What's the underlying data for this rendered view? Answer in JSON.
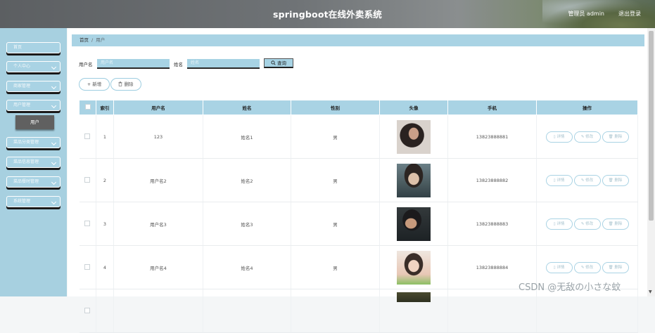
{
  "header": {
    "title": "springboot在线外卖系统",
    "user_text": "管理员 admin",
    "logout_label": "退出登录"
  },
  "sidebar": {
    "items": [
      {
        "label": "首页",
        "has_chevron": false
      },
      {
        "label": "个人中心",
        "has_chevron": true
      },
      {
        "label": "商家管理",
        "has_chevron": true
      },
      {
        "label": "用户管理",
        "has_chevron": true
      },
      {
        "label": "菜品分类管理",
        "has_chevron": true
      },
      {
        "label": "菜品信息管理",
        "has_chevron": true
      },
      {
        "label": "菜品餐时管理",
        "has_chevron": true
      },
      {
        "label": "系统管理",
        "has_chevron": true
      }
    ],
    "active_submenu": "用户"
  },
  "breadcrumb": {
    "home": "首页",
    "separator": "/",
    "current": "用户"
  },
  "search": {
    "username_label": "用户名",
    "username_placeholder": "用户名",
    "name_label": "姓名",
    "name_placeholder": "姓名",
    "search_button": "查询",
    "search_icon": "search-icon"
  },
  "actions": {
    "add_label": "新增",
    "delete_label": "删除"
  },
  "table": {
    "columns": [
      "索引",
      "用户名",
      "姓名",
      "性别",
      "头像",
      "手机",
      "操作"
    ],
    "rows": [
      {
        "index": "1",
        "username": "123",
        "name": "姓名1",
        "gender": "男",
        "phone": "13823888881"
      },
      {
        "index": "2",
        "username": "用户名2",
        "name": "姓名2",
        "gender": "男",
        "phone": "13823888882"
      },
      {
        "index": "3",
        "username": "用户名3",
        "name": "姓名3",
        "gender": "男",
        "phone": "13823888883"
      },
      {
        "index": "4",
        "username": "用户名4",
        "name": "姓名4",
        "gender": "男",
        "phone": "13823888884"
      }
    ],
    "row_actions": {
      "detail": "详情",
      "edit": "修改",
      "delete": "删除"
    }
  },
  "watermark": "CSDN @无敌の小さな蚊",
  "colors": {
    "accent": "#a9d3e4",
    "sidebar_bg": "#a7d0e0",
    "active_submenu_bg": "#606060"
  }
}
